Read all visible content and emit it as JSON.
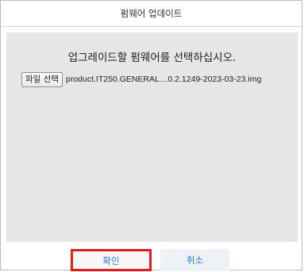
{
  "dialog": {
    "title": "펌웨어 업데이트",
    "instruction": "업그레이드할 펌웨어를 선택하십시오.",
    "file_button_label": "파일 선택",
    "selected_file": "product.IT250.GENERAL…0.2.1249-2023-03-23.img",
    "ok_label": "확인",
    "cancel_label": "취소"
  },
  "colors": {
    "content_background": "#e6e6e6",
    "button_text": "#2b7bd6",
    "highlight_border": "#e11e1e"
  }
}
